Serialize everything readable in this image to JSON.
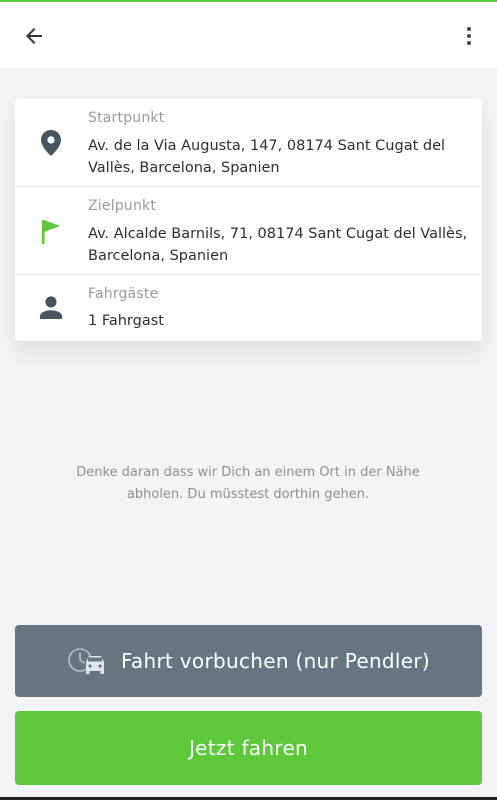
{
  "trip": {
    "start": {
      "label": "Startpunkt",
      "value": "Av. de la Via Augusta, 147, 08174 Sant Cugat del Vallès, Barcelona, Spanien"
    },
    "destination": {
      "label": "Zielpunkt",
      "value": "Av. Alcalde Barnils, 71, 08174 Sant Cugat del Vallès, Barcelona, Spanien"
    },
    "passengers": {
      "label": "Fahrgäste",
      "value": "1 Fahrgast"
    }
  },
  "hint": "Denke daran dass wir Dich an einem Ort in der Nähe abholen. Du müsstest dorthin gehen.",
  "buttons": {
    "prebook": "Fahrt vorbuchen (nur Pendler)",
    "ride_now": "Jetzt fahren"
  },
  "icons": {
    "back": "arrow-left-icon",
    "more": "more-vertical-icon",
    "start": "location-pin-icon",
    "destination": "flag-icon",
    "passengers": "person-icon",
    "prebook": "clock-car-icon"
  },
  "colors": {
    "accent": "#5dc93a",
    "secondary_button": "#667680",
    "icon_dark": "#465560"
  }
}
